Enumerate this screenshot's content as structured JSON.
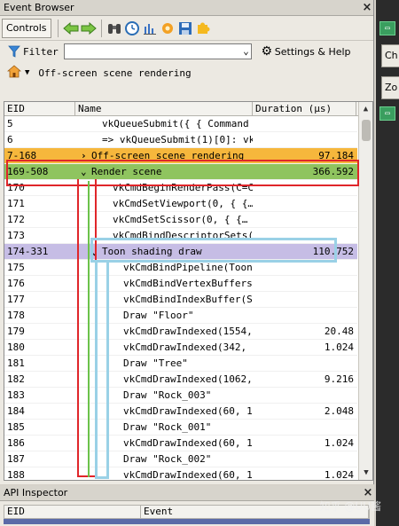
{
  "event_browser": {
    "title": "Event Browser",
    "toolbar": {
      "controls_label": "Controls",
      "icons": [
        "arrow-left-icon",
        "arrow-right-icon",
        "binoculars-icon",
        "clock-icon",
        "bar-chart-icon",
        "gear-flower-icon",
        "save-icon",
        "puzzle-icon"
      ]
    },
    "filter": {
      "label": "Filter",
      "value": ""
    },
    "settings_label": "Settings & Help",
    "breadcrumb": "Off-screen scene rendering",
    "columns": {
      "eid": "EID",
      "name": "Name",
      "duration": "Duration (µs)"
    },
    "rows": [
      {
        "eid": "5",
        "name": "vkQueueSubmit({ { Command",
        "duration": "",
        "indent": 2,
        "style": "",
        "expander": ""
      },
      {
        "eid": "6",
        "name": "=> vkQueueSubmit(1)[0]: vkE",
        "duration": "",
        "indent": 2,
        "style": "",
        "expander": ""
      },
      {
        "eid": "7-168",
        "name": "Off-screen scene rendering",
        "duration": "97.184",
        "indent": 1,
        "style": "orange",
        "expander": "›"
      },
      {
        "eid": "169-508",
        "name": "Render scene",
        "duration": "366.592",
        "indent": 1,
        "style": "green",
        "expander": "⌄"
      },
      {
        "eid": "170",
        "name": "vkCmdBeginRenderPass(C=C",
        "duration": "",
        "indent": 3,
        "style": "",
        "expander": ""
      },
      {
        "eid": "171",
        "name": "vkCmdSetViewport(0, { {…",
        "duration": "",
        "indent": 3,
        "style": "",
        "expander": ""
      },
      {
        "eid": "172",
        "name": "vkCmdSetScissor(0, { {…",
        "duration": "",
        "indent": 3,
        "style": "",
        "expander": ""
      },
      {
        "eid": "173",
        "name": "vkCmdBindDescriptorSets(0",
        "duration": "",
        "indent": 3,
        "style": "",
        "expander": ""
      },
      {
        "eid": "174-331",
        "name": "Toon shading draw",
        "duration": "110.752",
        "indent": 2,
        "style": "purple",
        "expander": "⌄"
      },
      {
        "eid": "175",
        "name": "vkCmdBindPipeline(Toon s",
        "duration": "",
        "indent": 4,
        "style": "",
        "expander": ""
      },
      {
        "eid": "176",
        "name": "vkCmdBindVertexBuffers(0,",
        "duration": "",
        "indent": 4,
        "style": "",
        "expander": ""
      },
      {
        "eid": "177",
        "name": "vkCmdBindIndexBuffer(Sce",
        "duration": "",
        "indent": 4,
        "style": "",
        "expander": ""
      },
      {
        "eid": "178",
        "name": "Draw \"Floor\"",
        "duration": "",
        "indent": 4,
        "style": "",
        "expander": ""
      },
      {
        "eid": "179",
        "name": "vkCmdDrawIndexed(1554,…",
        "duration": "20.48",
        "indent": 4,
        "style": "",
        "expander": ""
      },
      {
        "eid": "180",
        "name": "vkCmdDrawIndexed(342, 1)",
        "duration": "1.024",
        "indent": 4,
        "style": "",
        "expander": ""
      },
      {
        "eid": "181",
        "name": "Draw \"Tree\"",
        "duration": "",
        "indent": 4,
        "style": "",
        "expander": ""
      },
      {
        "eid": "182",
        "name": "vkCmdDrawIndexed(1062,…",
        "duration": "9.216",
        "indent": 4,
        "style": "",
        "expander": ""
      },
      {
        "eid": "183",
        "name": "Draw \"Rock_003\"",
        "duration": "",
        "indent": 4,
        "style": "",
        "expander": ""
      },
      {
        "eid": "184",
        "name": "vkCmdDrawIndexed(60, 1)",
        "duration": "2.048",
        "indent": 4,
        "style": "",
        "expander": ""
      },
      {
        "eid": "185",
        "name": "Draw \"Rock_001\"",
        "duration": "",
        "indent": 4,
        "style": "",
        "expander": ""
      },
      {
        "eid": "186",
        "name": "vkCmdDrawIndexed(60, 1)",
        "duration": "1.024",
        "indent": 4,
        "style": "",
        "expander": ""
      },
      {
        "eid": "187",
        "name": "Draw \"Rock_002\"",
        "duration": "",
        "indent": 4,
        "style": "",
        "expander": ""
      },
      {
        "eid": "188",
        "name": "vkCmdDrawIndexed(60, 1)",
        "duration": "1.024",
        "indent": 4,
        "style": "",
        "expander": ""
      }
    ]
  },
  "side_tabs": [
    "Ch",
    "Zo"
  ],
  "api_inspector": {
    "title": "API Inspector",
    "columns": {
      "eid": "EID",
      "event": "Event"
    }
  },
  "watermark": "知乎 @UU酱",
  "colors": {
    "orange": "#f6b73c",
    "green": "#8fc45f",
    "purple": "#c6bde5",
    "annotation_red": "#e0262a",
    "annotation_blue": "#9ad1e6"
  }
}
